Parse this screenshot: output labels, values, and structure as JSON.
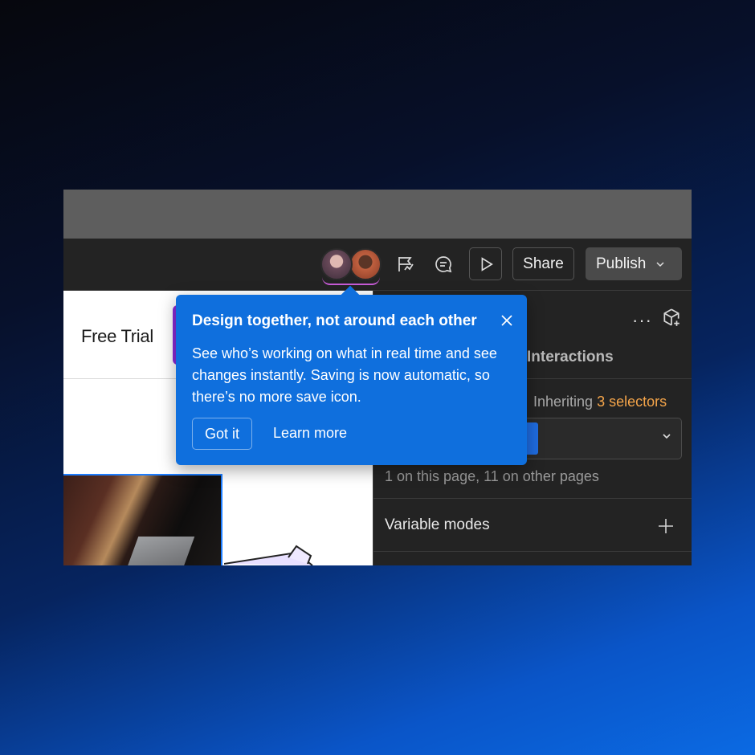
{
  "toolbar": {
    "share_label": "Share",
    "publish_label": "Publish"
  },
  "canvas": {
    "nav_text": "Free Trial"
  },
  "panel": {
    "tab_interactions": "Interactions",
    "inheriting_prefix": "Inheriting",
    "inheriting_selectors": "3 selectors",
    "usage_text": "1 on this page, 11 on other pages",
    "variable_modes_label": "Variable modes",
    "more_label": "···"
  },
  "tooltip": {
    "title": "Design together, not around each other",
    "body": "See who’s working on what in real time and see changes instantly. Saving is now automatic, so there’s no more save icon.",
    "primary_label": "Got it",
    "secondary_label": "Learn more"
  },
  "colors": {
    "tooltip_bg": "#0f6fdd",
    "accent_orange": "#f5a54a",
    "accent_purple": "#8c2bd9",
    "selection_blue": "#1d7dff"
  }
}
